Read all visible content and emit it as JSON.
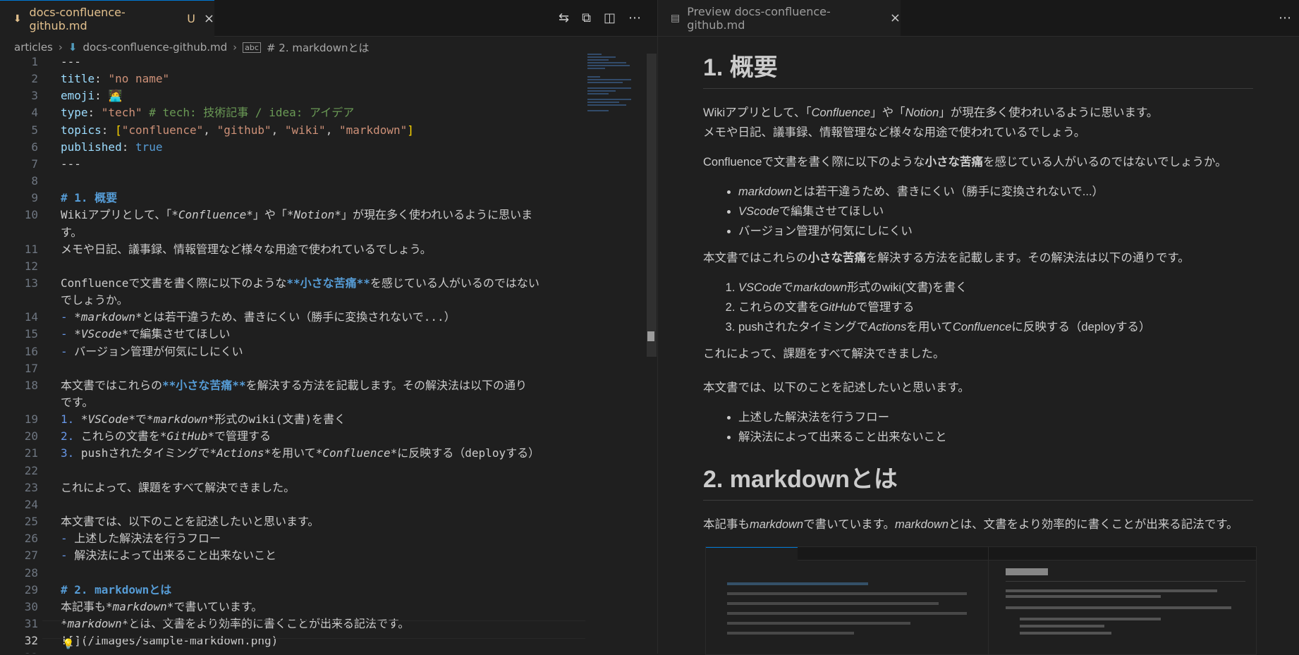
{
  "editor": {
    "tab": {
      "filename": "docs-confluence-github.md",
      "modified": "U"
    },
    "breadcrumb": {
      "folder": "articles",
      "file": "docs-confluence-github.md",
      "symbol": "# 2. markdownとは"
    },
    "lines": [
      {
        "n": "1",
        "t": "---"
      },
      {
        "n": "2",
        "k": "title",
        "v": "\"no name\""
      },
      {
        "n": "3",
        "k": "emoji",
        "v": "🧑‍💻"
      },
      {
        "n": "4",
        "k": "type",
        "v": "\"tech\"",
        "c": "# tech: 技術記事 / idea: アイデア"
      },
      {
        "n": "5",
        "k": "topics",
        "v": "[\"confluence\", \"github\", \"wiki\", \"markdown\"]"
      },
      {
        "n": "6",
        "k": "published",
        "v": "true"
      },
      {
        "n": "7",
        "t": "---"
      },
      {
        "n": "8",
        "t": ""
      },
      {
        "n": "9",
        "t": "# 1. 概要"
      },
      {
        "n": "10",
        "t": "Wikiアプリとして、「*Confluence*」や「*Notion*」が現在多く使われいるように思いま"
      },
      {
        "n": "",
        "t": "す。"
      },
      {
        "n": "11",
        "t": "メモや日記、議事録、情報管理など様々な用途で使われているでしょう。"
      },
      {
        "n": "12",
        "t": ""
      },
      {
        "n": "13",
        "t": "Confluenceで文書を書く際に以下のような**小さな苦痛**を感じている人がいるのではない"
      },
      {
        "n": "",
        "t": "でしょうか。"
      },
      {
        "n": "14",
        "t": "- *markdown*とは若干違うため、書きにくい（勝手に変換されないで...）"
      },
      {
        "n": "15",
        "t": "- *VScode*で編集させてほしい"
      },
      {
        "n": "16",
        "t": "- バージョン管理が何気にしにくい"
      },
      {
        "n": "17",
        "t": ""
      },
      {
        "n": "18",
        "t": "本文書ではこれらの**小さな苦痛**を解決する方法を記載します。その解決法は以下の通り"
      },
      {
        "n": "",
        "t": "です。"
      },
      {
        "n": "19",
        "t": "1. *VSCode*で*markdown*形式のwiki(文書)を書く"
      },
      {
        "n": "20",
        "t": "2. これらの文書を*GitHub*で管理する"
      },
      {
        "n": "21",
        "t": "3. pushされたタイミングで*Actions*を用いて*Confluence*に反映する（deployする）"
      },
      {
        "n": "22",
        "t": ""
      },
      {
        "n": "23",
        "t": "これによって、課題をすべて解決できました。"
      },
      {
        "n": "24",
        "t": ""
      },
      {
        "n": "25",
        "t": "本文書では、以下のことを記述したいと思います。"
      },
      {
        "n": "26",
        "t": "- 上述した解決法を行うフロー"
      },
      {
        "n": "27",
        "t": "- 解決法によって出来ること出来ないこと"
      },
      {
        "n": "28",
        "t": ""
      },
      {
        "n": "29",
        "t": "# 2. markdownとは"
      },
      {
        "n": "30",
        "t": "本記事も*markdown*で書いています。"
      },
      {
        "n": "31",
        "t": "*markdown*とは、文書をより効率的に書くことが出来る記法です。"
      },
      {
        "n": "32",
        "t": "![](/images/sample-markdown.png)"
      },
      {
        "n": "33",
        "t": ""
      }
    ]
  },
  "preview": {
    "tab": {
      "title": "Preview docs-confluence-github.md"
    },
    "h1": "1. 概要",
    "p1a": "Wikiアプリとして、「",
    "p1b": "Confluence",
    "p1c": "」や「",
    "p1d": "Notion",
    "p1e": "」が現在多く使われいるように思います。",
    "p1f": "メモや日記、議事録、情報管理など様々な用途で使われているでしょう。",
    "p2a": "Confluenceで文書を書く際に以下のような",
    "p2b": "小さな苦痛",
    "p2c": "を感じている人がいるのではないでしょうか。",
    "ul1": [
      {
        "em": "markdown",
        "rest": "とは若干違うため、書きにくい（勝手に変換されないで...）"
      },
      {
        "em": "VScode",
        "rest": "で編集させてほしい"
      },
      {
        "em": "",
        "rest": "バージョン管理が何気にしにくい"
      }
    ],
    "p3a": "本文書ではこれらの",
    "p3b": "小さな苦痛",
    "p3c": "を解決する方法を記載します。その解決法は以下の通りです。",
    "ol1": [
      "VSCodeでmarkdown形式のwiki(文書)を書く",
      "これらの文書をGitHubで管理する",
      "pushされたタイミングでActionsを用いてConfluenceに反映する（deployする）"
    ],
    "p4": "これによって、課題をすべて解決できました。",
    "p5": "本文書では、以下のことを記述したいと思います。",
    "ul2": [
      "上述した解決法を行うフロー",
      "解決法によって出来ること出来ないこと"
    ],
    "h2": "2. markdownとは",
    "p6a": "本記事も",
    "p6b": "markdown",
    "p6c": "で書いています。",
    "p6d": "markdown",
    "p6e": "とは、文書をより効率的に書くことが出来る記法です。"
  }
}
